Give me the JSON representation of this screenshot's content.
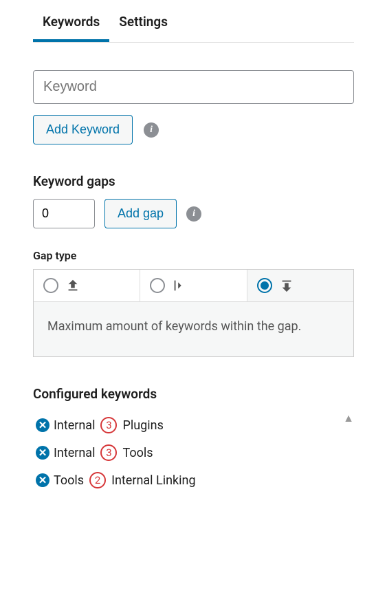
{
  "tabs": {
    "keywords": "Keywords",
    "settings": "Settings"
  },
  "keyword_input": {
    "placeholder": "Keyword",
    "value": ""
  },
  "add_keyword_label": "Add Keyword",
  "keyword_gaps_heading": "Keyword gaps",
  "gap_value": "0",
  "add_gap_label": "Add gap",
  "gap_type_heading": "Gap type",
  "gap_type_description": "Maximum amount of keywords within the gap.",
  "configured_heading": "Configured keywords",
  "configured": [
    {
      "before": "Internal",
      "gap": "3",
      "after": "Plugins"
    },
    {
      "before": "Internal",
      "gap": "3",
      "after": "Tools"
    },
    {
      "before": "Tools",
      "gap": "2",
      "after": "Internal Linking"
    }
  ],
  "info_glyph": "i",
  "remove_glyph": "✕"
}
